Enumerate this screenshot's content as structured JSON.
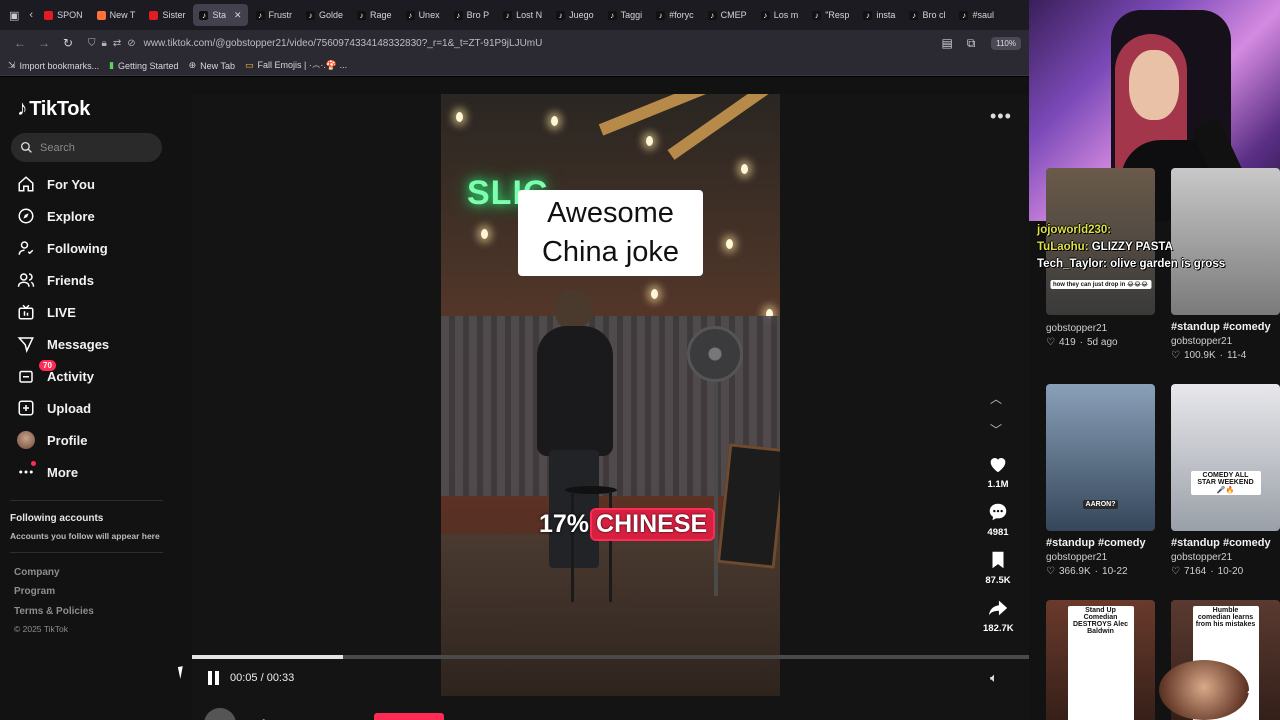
{
  "browser": {
    "tabs": [
      {
        "label": "SPON",
        "color": "#e31b23"
      },
      {
        "label": "New T",
        "color": "#ff7139"
      },
      {
        "label": "Sister",
        "color": "#e31b23"
      },
      {
        "label": "Sta",
        "color": "#111111",
        "active": true
      },
      {
        "label": "Frustr",
        "color": "#111111"
      },
      {
        "label": "Golde",
        "color": "#111111"
      },
      {
        "label": "Rage",
        "color": "#111111"
      },
      {
        "label": "Unex",
        "color": "#111111"
      },
      {
        "label": "Bro P",
        "color": "#111111"
      },
      {
        "label": "Lost N",
        "color": "#111111"
      },
      {
        "label": "Juego",
        "color": "#111111"
      },
      {
        "label": "Taggi",
        "color": "#111111"
      },
      {
        "label": "#foryc",
        "color": "#111111"
      },
      {
        "label": "CMEP",
        "color": "#111111"
      },
      {
        "label": "Los m",
        "color": "#111111"
      },
      {
        "label": "\"Resp",
        "color": "#111111"
      },
      {
        "label": "insta",
        "color": "#111111"
      },
      {
        "label": "Bro cl",
        "color": "#111111"
      },
      {
        "label": "#saul",
        "color": "#111111"
      }
    ],
    "url": "www.tiktok.com/@gobstopper21/video/7560974334148332830?_r=1&_t=ZT-91P9jLJUmU",
    "zoom": "110%",
    "bookmarks": [
      {
        "label": "Import bookmarks...",
        "icon": "import-icon"
      },
      {
        "label": "Getting Started",
        "icon": "firefox-icon"
      },
      {
        "label": "New Tab",
        "icon": "globe-icon"
      },
      {
        "label": "Fall Emojis | ·෴·.🍄 ...",
        "icon": "folder-icon"
      }
    ]
  },
  "tiktok": {
    "logo": "TikTok",
    "search_placeholder": "Search",
    "nav": [
      {
        "label": "For You",
        "icon": "home-icon"
      },
      {
        "label": "Explore",
        "icon": "explore-icon"
      },
      {
        "label": "Following",
        "icon": "following-icon"
      },
      {
        "label": "Friends",
        "icon": "friends-icon"
      },
      {
        "label": "LIVE",
        "icon": "live-icon"
      },
      {
        "label": "Messages",
        "icon": "messages-icon"
      },
      {
        "label": "Activity",
        "icon": "activity-icon",
        "badge": "70"
      },
      {
        "label": "Upload",
        "icon": "upload-icon"
      },
      {
        "label": "Profile",
        "icon": "avatar"
      },
      {
        "label": "More",
        "icon": "more-icon"
      }
    ],
    "following_accounts": {
      "title": "Following accounts",
      "subtitle": "Accounts you follow will appear here"
    },
    "footer": {
      "links": [
        "Company",
        "Program",
        "Terms & Policies"
      ],
      "copyright": "© 2025 TikTok"
    }
  },
  "video": {
    "caption": "Awesome China joke",
    "overlay_number": "17%",
    "overlay_word": "CHINESE",
    "neon_sign": "SLIC",
    "likes": "1.1M",
    "comments": "4981",
    "saves": "87.5K",
    "shares": "182.7K",
    "time": "00:05 / 00:33",
    "progress": 0.18,
    "author": "gobstopper21"
  },
  "stream_chat": [
    {
      "user": "jojoworld230:",
      "message": ""
    },
    {
      "user": "TuLaohu:",
      "message": "GLIZZY PASTA"
    },
    {
      "user": "Tech_Taylor:",
      "message": "olive garden is gross"
    }
  ],
  "grid": [
    {
      "title": "",
      "user": "gobstopper21",
      "likes": "419",
      "date": "5d ago",
      "label": "how they can just drop in 😂😂😂"
    },
    {
      "title": "#standup #comedy",
      "user": "gobstopper21",
      "likes": "100.9K",
      "date": "11-4",
      "label": ""
    },
    {
      "title": "#standup #comedy",
      "user": "gobstopper21",
      "likes": "366.9K",
      "date": "10-22",
      "label": "AARON?"
    },
    {
      "title": "#standup #comedy",
      "user": "gobstopper21",
      "likes": "7164",
      "date": "10-20",
      "label": "COMEDY ALL STAR WEEKEND 🎤🔥"
    },
    {
      "title": "",
      "user": "",
      "likes": "",
      "date": "",
      "label": "Stand Up Comedian DESTROYS Alec Baldwin"
    },
    {
      "title": "",
      "user": "",
      "likes": "",
      "date": "",
      "label": "Humble comedian learns from his mistakes"
    }
  ],
  "overlay_counter": "3"
}
